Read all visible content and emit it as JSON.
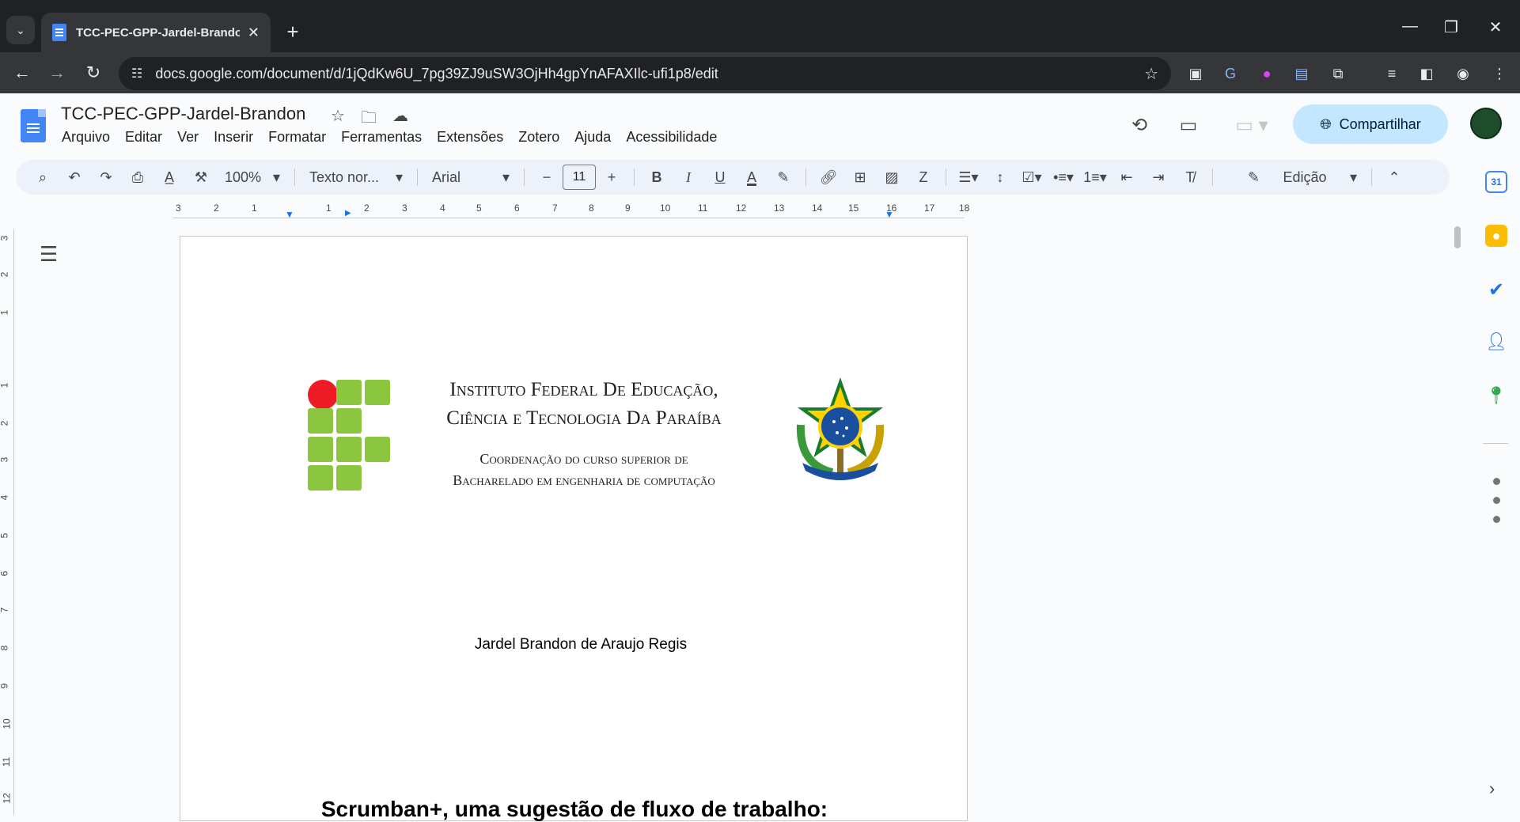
{
  "browser": {
    "tab_title": "TCC-PEC-GPP-Jardel-Brandon",
    "tab_close": "✕",
    "new_tab": "+",
    "url": "docs.google.com/document/d/1jQdKw6U_7pg39ZJ9uSW3OjHh4gpYnAFAXIlc-ufi1p8/edit",
    "window_controls": {
      "minimize": "—",
      "maximize": "❐",
      "close": "✕"
    }
  },
  "docs": {
    "title": "TCC-PEC-GPP-Jardel-Brandon",
    "menu": [
      "Arquivo",
      "Editar",
      "Ver",
      "Inserir",
      "Formatar",
      "Ferramentas",
      "Extensões",
      "Zotero",
      "Ajuda",
      "Acessibilidade"
    ],
    "share_label": "Compartilhar"
  },
  "toolbar": {
    "zoom": "100%",
    "style": "Texto nor...",
    "font": "Arial",
    "font_size": "11",
    "mode": "Edição"
  },
  "ruler": {
    "numbers": [
      "3",
      "2",
      "1",
      "1",
      "2",
      "3",
      "4",
      "5",
      "6",
      "7",
      "8",
      "9",
      "10",
      "11",
      "12",
      "13",
      "14",
      "15",
      "16",
      "17",
      "18"
    ],
    "vertical_numbers": [
      "3",
      "2",
      "1",
      "1",
      "2",
      "3",
      "4",
      "5",
      "6",
      "7",
      "8",
      "9",
      "10",
      "11",
      "12"
    ]
  },
  "document": {
    "institution_line1": "Instituto Federal De Educação,",
    "institution_line2": "Ciência e Tecnologia Da Paraíba",
    "coord_line1": "Coordenação do curso superior de",
    "coord_line2": "Bacharelado em engenharia de computação",
    "author": "Jardel Brandon de Araujo Regis",
    "heading": "Scrumban+, uma sugestão de fluxo de trabalho:"
  },
  "colors": {
    "ifpb_green": "#8cc63f",
    "ifpb_red": "#ed1c24",
    "share_bg": "#c2e7ff",
    "docs_blue": "#4285f4"
  }
}
